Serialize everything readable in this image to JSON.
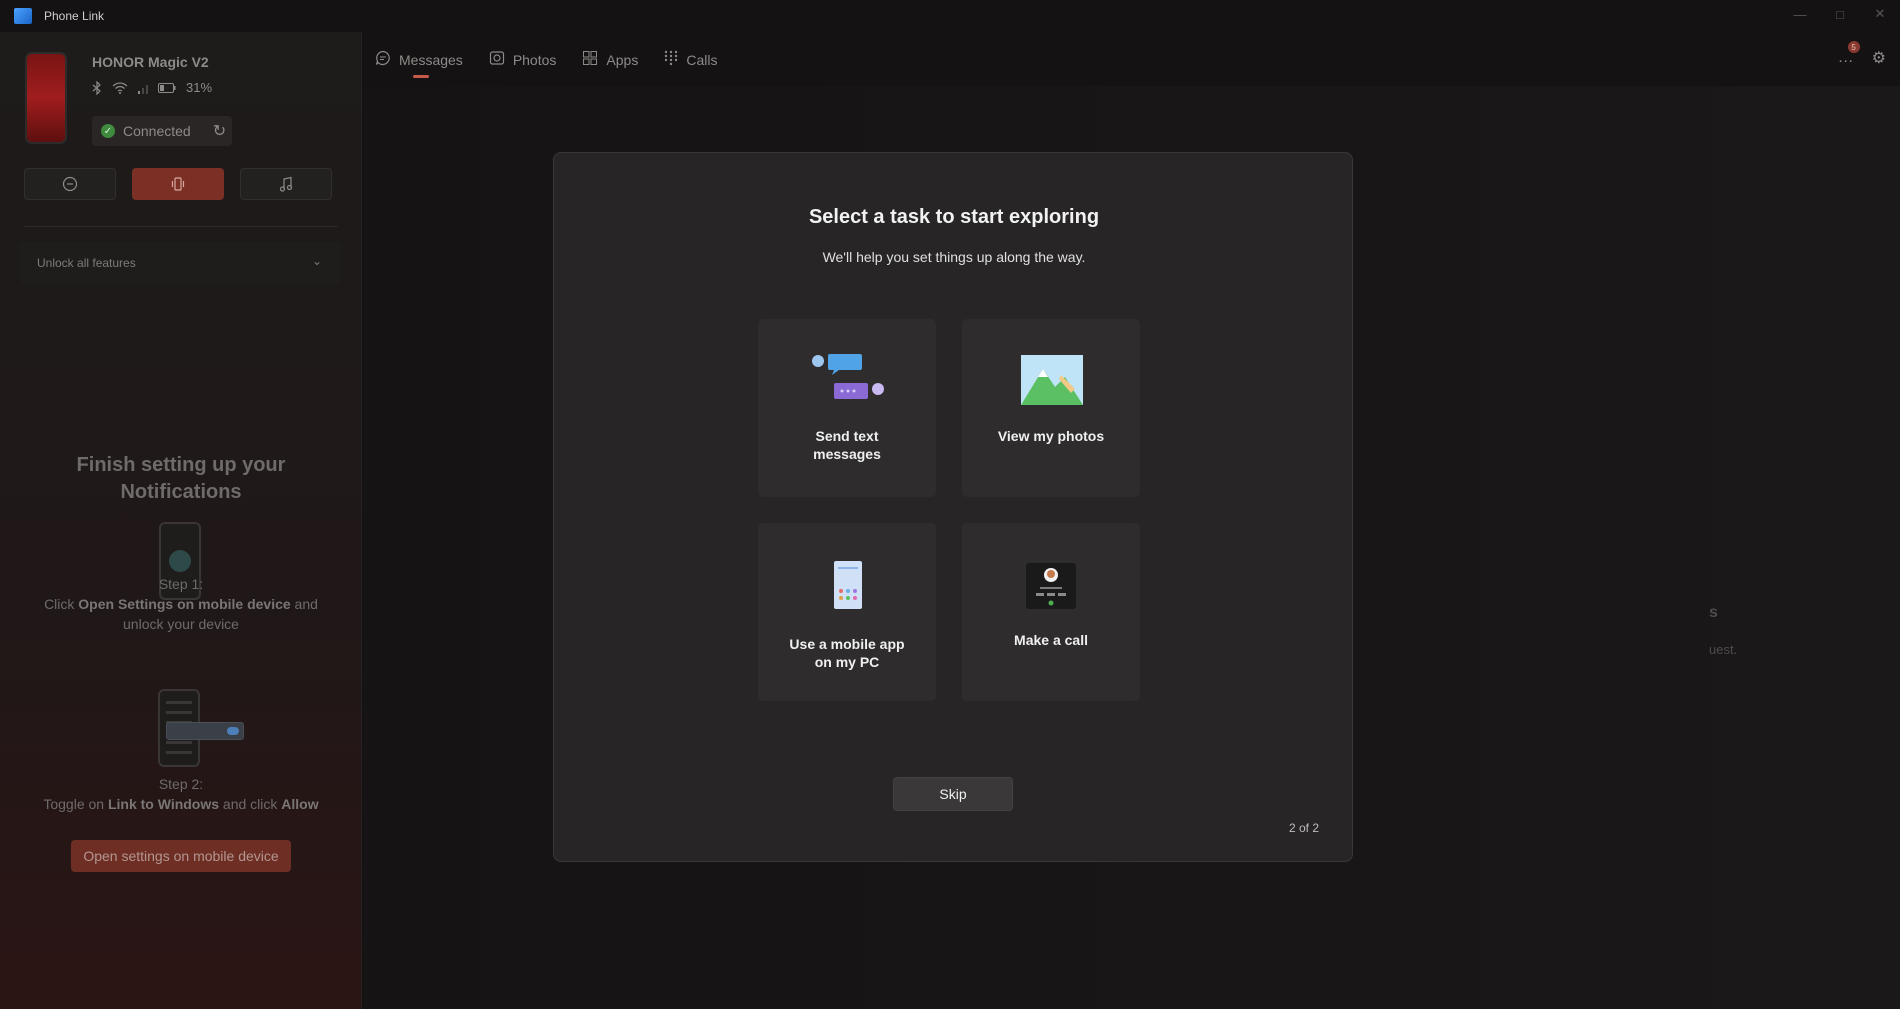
{
  "window": {
    "title": "Phone Link",
    "controls": [
      "minimize",
      "maximize",
      "close"
    ]
  },
  "device": {
    "name": "HONOR Magic V2",
    "battery": "31%",
    "connection_status": "Connected"
  },
  "sidebar": {
    "mode_buttons": [
      "do-not-disturb",
      "vibrate",
      "music"
    ],
    "unlock_label": "Unlock all features",
    "setup_title_line1": "Finish setting up your",
    "setup_title_line2": "Notifications",
    "step1_label": "Step 1:",
    "step1_text_pre": "Click ",
    "step1_text_bold": "Open Settings on mobile device",
    "step1_text_post": " and",
    "step1_text_line2": "unlock your device",
    "step2_label": "Step 2:",
    "step2_text_pre": "Toggle on ",
    "step2_text_bold1": "Link to Windows",
    "step2_text_mid": " and click ",
    "step2_text_bold2": "Allow",
    "open_settings_button": "Open settings on mobile device"
  },
  "nav": {
    "tabs": [
      {
        "label": "Messages",
        "icon": "chat-icon",
        "active": true
      },
      {
        "label": "Photos",
        "icon": "photo-icon",
        "active": false
      },
      {
        "label": "Apps",
        "icon": "apps-icon",
        "active": false
      },
      {
        "label": "Calls",
        "icon": "dialpad-icon",
        "active": false
      }
    ],
    "notification_count": "5"
  },
  "background": {
    "fragment1": "s",
    "fragment2": "uest."
  },
  "dialog": {
    "title": "Select a task to start exploring",
    "subtitle": "We'll help you set things up along the way.",
    "cards": [
      {
        "line1": "Send text",
        "line2": "messages"
      },
      {
        "line1": "View my photos"
      },
      {
        "line1": "Use a mobile app",
        "line2": "on my PC"
      },
      {
        "line1": "Make a call"
      }
    ],
    "skip_label": "Skip",
    "pager": "2 of 2"
  },
  "colors": {
    "accent": "#c65a4a",
    "accent_button": "#7c2f24",
    "dialog_bg": "#272525",
    "card_bg": "#2e2c2c"
  }
}
